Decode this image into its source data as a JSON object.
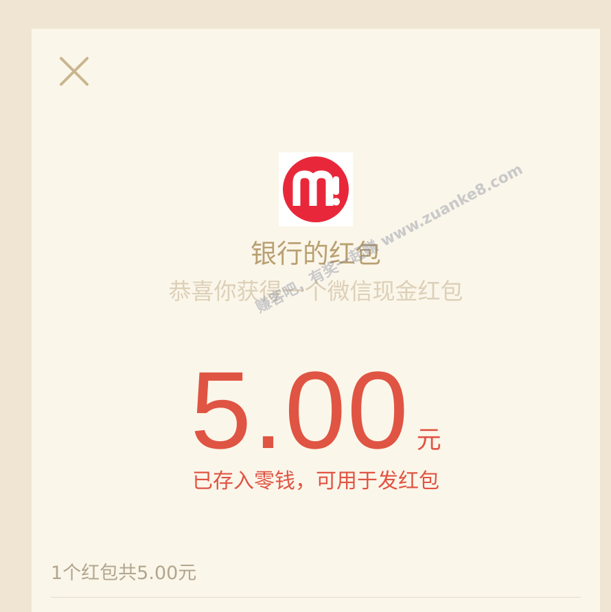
{
  "close_button": {
    "icon": "close-icon"
  },
  "logo": {
    "icon": "bank-m-logo",
    "color": "#e8283a"
  },
  "sender_title": "银行的红包",
  "greeting": "恭喜你获得一个微信现金红包",
  "amount": {
    "value": "5.00",
    "unit": "元"
  },
  "deposit_note": "已存入零钱，可用于发红包",
  "summary": "1个红包共5.00元",
  "watermark": "赚客吧，有奖一起赚 www.zuanke8.com",
  "colors": {
    "background": "#efe5d2",
    "card": "#fbf6ea",
    "accent_gold": "#b9a072",
    "amount_red": "#e05443"
  }
}
